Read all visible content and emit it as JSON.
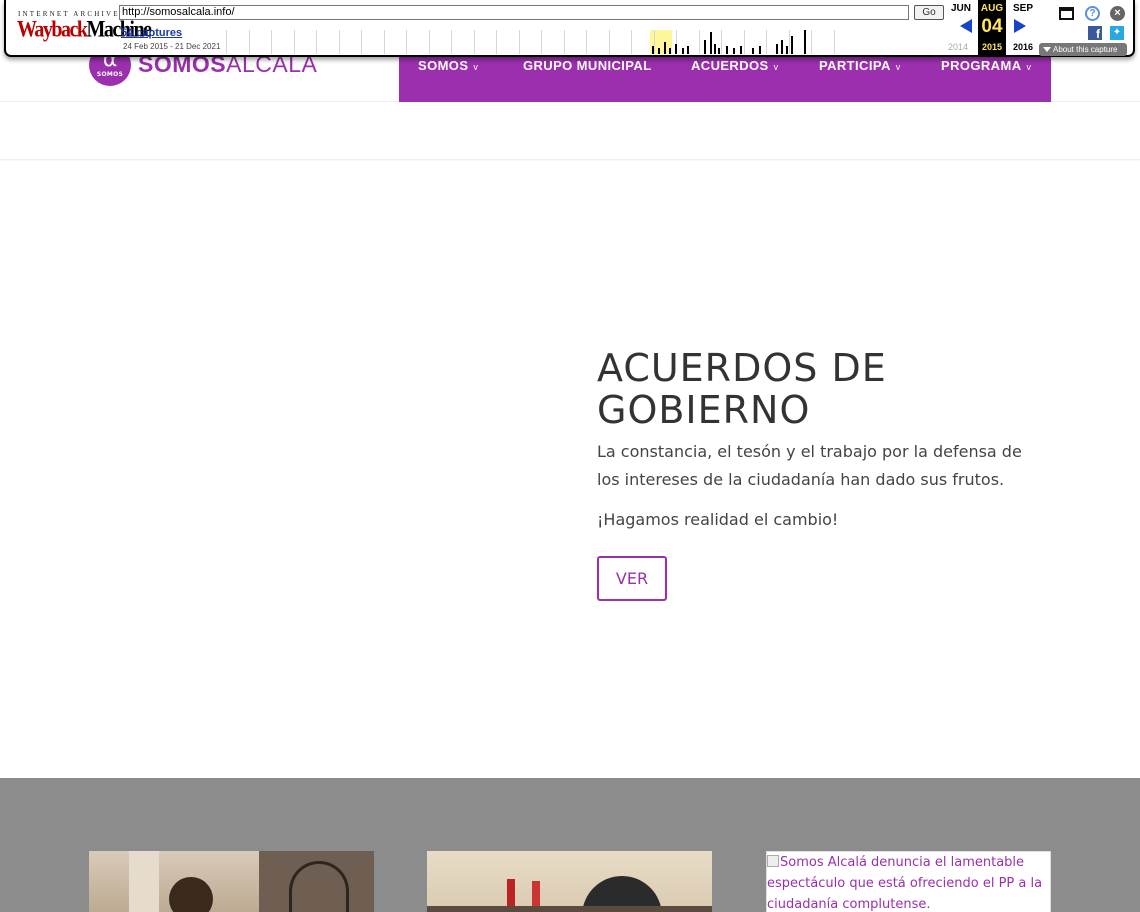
{
  "wayback": {
    "logo_top": "INTERNET ARCHIVE",
    "logo_main_1": "Wayback",
    "logo_main_2": "Machine",
    "url": "http://somosalcala.info/",
    "go_label": "Go",
    "captures_label": "54 captures",
    "date_range": "24 Feb 2015 - 21 Dec 2021",
    "prev_month": "JUN",
    "current_month": "AUG",
    "next_month": "SEP",
    "current_day": "04",
    "prev_year": "2014",
    "current_year": "2015",
    "next_year": "2016",
    "about_label": "About this capture",
    "icons": [
      "window-icon",
      "help-icon",
      "close-icon",
      "facebook-icon",
      "twitter-icon"
    ]
  },
  "site": {
    "logo": {
      "circle_glyph": "α",
      "circle_small": "SOMOS",
      "name_bold": "SOMOS",
      "name_regular": "ALCALA"
    },
    "nav": [
      {
        "label": "SOMOS",
        "has_dropdown": true
      },
      {
        "label": "GRUPO MUNICIPAL",
        "has_dropdown": false
      },
      {
        "label": "ACUERDOS",
        "has_dropdown": true
      },
      {
        "label": "PARTICIPA",
        "has_dropdown": true
      },
      {
        "label": "PROGRAMA",
        "has_dropdown": true
      }
    ],
    "chevron": "v"
  },
  "hero": {
    "title": "ACUERDOS DE GOBIERNO",
    "description": "La constancia, el tesón y el trabajo por la defensa de los intereses de la ciudadanía han dado sus frutos.",
    "cta_text": "¡Hagamos realidad el cambio!",
    "button_label": "VER"
  },
  "news": {
    "card3_alt": "Somos Alcalá denuncia el lamentable espectáculo que está ofreciendo el PP a la ciudadanía complutense."
  },
  "colors": {
    "brand": "#9b2fae",
    "gray_section": "#8c8c8c",
    "wayback_highlight": "#ffe55c"
  }
}
